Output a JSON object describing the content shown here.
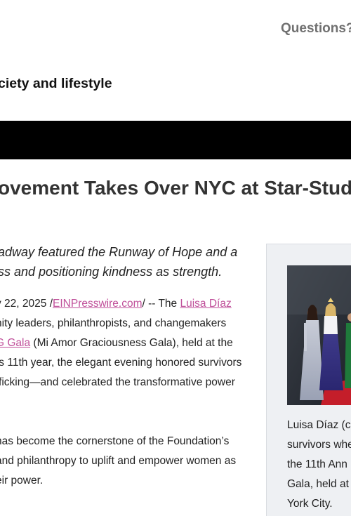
{
  "header": {
    "questions_label": "Questions?",
    "tagline": "ciety and lifestyle"
  },
  "article": {
    "headline": "ovement Takes Over NYC at Star-Stud",
    "lede_lines": [
      "adway featured the Runway of Hope and a",
      "ss and positioning kindness as strength."
    ],
    "para1": {
      "line1_pre": "y 22, 2025 /",
      "source_link": "EINPresswire.com",
      "line1_mid": "/ -- The ",
      "person_link": "Luisa Díaz",
      "line2": "nity leaders, philanthropists, and changemakers",
      "gala_link": "G Gala",
      "line3_post": " (Mi Amor Graciousness Gala), held at the",
      "line4": "ts 11th year, the elegant evening honored survivors",
      "line5": "fficking—and celebrated the transformative power"
    },
    "para2": {
      "line1": "has become the cornerstone of the Foundation’s",
      "line2": "and philanthropy to uplift and empower women as",
      "line3": "eir power."
    }
  },
  "sidebar": {
    "caption_lines": [
      "Luisa Díaz (c",
      "survivors whe",
      "the 11th Ann",
      "Gala, held at",
      "York City."
    ]
  },
  "colors": {
    "link": "#c0509a",
    "bar": "#000000",
    "sidebar_bg": "#eef0f3"
  }
}
